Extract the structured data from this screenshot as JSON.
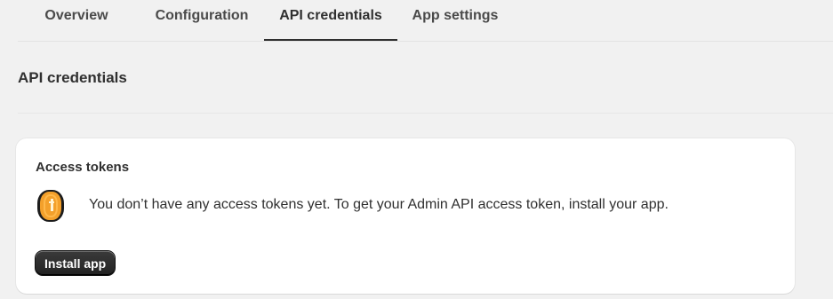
{
  "tabs": [
    {
      "label": "Overview",
      "active": false
    },
    {
      "label": "Configuration",
      "active": false
    },
    {
      "label": "API credentials",
      "active": true
    },
    {
      "label": "App settings",
      "active": false
    }
  ],
  "section": {
    "title": "API credentials"
  },
  "access_tokens": {
    "title": "Access tokens",
    "icon": "coin-icon",
    "message": "You don’t have any access tokens yet. To get your Admin API access token, install your app.",
    "install_button_label": "Install app"
  },
  "colors": {
    "background": "#f1f1f1",
    "card": "#ffffff",
    "primary_button": "#303030",
    "coin": "#f5a623"
  }
}
